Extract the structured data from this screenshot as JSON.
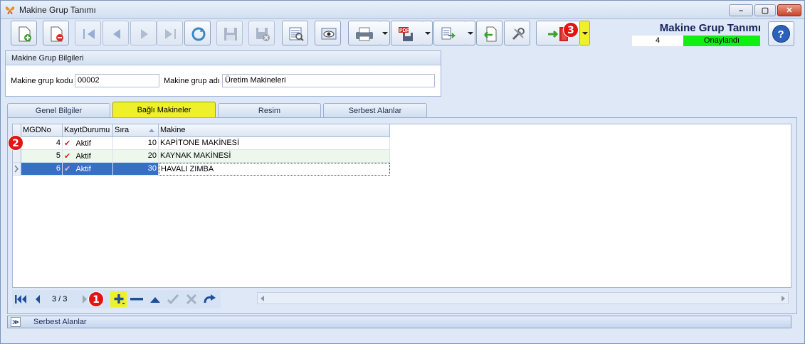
{
  "window": {
    "title": "Makine Grup Tanımı",
    "minimize": "–",
    "maximize": "▢",
    "close": "✕"
  },
  "toolbar": {
    "buttons": [
      {
        "name": "new-record-button",
        "icon": "new-document-icon"
      },
      {
        "name": "delete-record-button",
        "icon": "delete-document-icon"
      },
      {
        "name": "first-record-button",
        "icon": "first-icon"
      },
      {
        "name": "previous-record-button",
        "icon": "previous-icon"
      },
      {
        "name": "next-record-button",
        "icon": "next-icon"
      },
      {
        "name": "last-record-button",
        "icon": "last-icon"
      },
      {
        "name": "refresh-button",
        "icon": "refresh-icon"
      },
      {
        "name": "save-button",
        "icon": "save-icon"
      },
      {
        "name": "cancel-save-button",
        "icon": "cancel-save-icon"
      },
      {
        "name": "report-button",
        "icon": "report-icon"
      },
      {
        "name": "preview-button",
        "icon": "preview-icon"
      },
      {
        "name": "print-button",
        "icon": "printer-icon"
      },
      {
        "name": "pdf-export-button",
        "icon": "pdf-icon"
      },
      {
        "name": "export-button",
        "icon": "export-icon"
      },
      {
        "name": "import-button",
        "icon": "import-icon"
      },
      {
        "name": "tools-button",
        "icon": "tools-icon"
      },
      {
        "name": "exit-button",
        "icon": "exit-door-icon"
      }
    ]
  },
  "header": {
    "title": "Makine Grup Tanımı",
    "record_number": "4",
    "status": "Onaylandı",
    "status_color": "#11ee11"
  },
  "group": {
    "title": "Makine Grup Bilgileri",
    "code_label": "Makine grup kodu",
    "code_value": "00002",
    "name_label": "Makine grup adı",
    "name_value": "Üretim Makineleri"
  },
  "tabs": [
    {
      "label": "Genel Bilgiler",
      "active": false
    },
    {
      "label": "Bağlı Makineler",
      "active": true
    },
    {
      "label": "Resim",
      "active": false
    },
    {
      "label": "Serbest Alanlar",
      "active": false
    }
  ],
  "grid": {
    "columns": [
      "MGDNo",
      "KayıtDurumu",
      "Sıra",
      "Makine"
    ],
    "rows": [
      {
        "mgdno": "4",
        "status": "Aktif",
        "sira": "10",
        "makine": "KAPİTONE MAKİNESİ"
      },
      {
        "mgdno": "5",
        "status": "Aktif",
        "sira": "20",
        "makine": "KAYNAK MAKİNESİ"
      },
      {
        "mgdno": "6",
        "status": "Aktif",
        "sira": "30",
        "makine": "HAVALI ZIMBA"
      }
    ],
    "check_glyph": "✔"
  },
  "navigator": {
    "page_indicator": "3 / 3"
  },
  "badges": {
    "one": "1",
    "two": "2",
    "three": "3"
  },
  "footer": {
    "label": "Serbest Alanlar",
    "collapse_glyph": "≫"
  },
  "colors": {
    "highlight_yellow": "#eef02a",
    "selection_blue": "#3670c6",
    "badge_red": "#e21414"
  }
}
